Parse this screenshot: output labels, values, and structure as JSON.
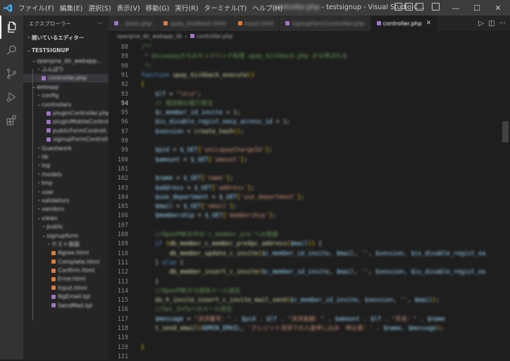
{
  "titlebar": {
    "menu": [
      "ファイル(F)",
      "編集(E)",
      "選択(S)",
      "表示(V)",
      "移動(G)",
      "実行(R)",
      "ターミナル(T)",
      "ヘルプ(H)"
    ],
    "title_prefix": "controller.php",
    "title": " - testsignup - Visual Studio C...",
    "minimize": "—",
    "maximize": "☐",
    "close": "✕"
  },
  "sidebar": {
    "header": "エクスプローラー",
    "more": "···",
    "open_editors": "開いているエディター",
    "workspace": "TESTSIGNUP",
    "items": [
      {
        "label": "openpne_dir_webapp...",
        "depth": 1,
        "tw": "⌄",
        "color": ""
      },
      {
        "label": "ふんばり",
        "depth": 2,
        "tw": "›",
        "color": ""
      },
      {
        "label": "controller.php",
        "depth": 2,
        "tw": "",
        "color": "#a074c4",
        "selected": true
      },
      {
        "label": "webapp",
        "depth": 1,
        "tw": "⌄",
        "color": ""
      },
      {
        "label": "config",
        "depth": 2,
        "tw": "›",
        "color": ""
      },
      {
        "label": "controllers",
        "depth": 2,
        "tw": "⌄",
        "color": ""
      },
      {
        "label": "pluginController.php",
        "depth": 3,
        "tw": "",
        "color": "#a074c4"
      },
      {
        "label": "pluginMobileControll...",
        "depth": 3,
        "tw": "",
        "color": "#a074c4"
      },
      {
        "label": "publicFormControll...",
        "depth": 3,
        "tw": "",
        "color": "#a074c4"
      },
      {
        "label": "signupFormControll...",
        "depth": 3,
        "tw": "",
        "color": "#a074c4"
      },
      {
        "label": "Guestwork",
        "depth": 2,
        "tw": "›",
        "color": ""
      },
      {
        "label": "lib",
        "depth": 2,
        "tw": "›",
        "color": ""
      },
      {
        "label": "log",
        "depth": 2,
        "tw": "›",
        "color": ""
      },
      {
        "label": "models",
        "depth": 2,
        "tw": "›",
        "color": ""
      },
      {
        "label": "tmp",
        "depth": 2,
        "tw": "›",
        "color": ""
      },
      {
        "label": "user",
        "depth": 2,
        "tw": "›",
        "color": ""
      },
      {
        "label": "validators",
        "depth": 2,
        "tw": "›",
        "color": ""
      },
      {
        "label": "vendors",
        "depth": 2,
        "tw": "›",
        "color": ""
      },
      {
        "label": "views",
        "depth": 2,
        "tw": "⌄",
        "color": ""
      },
      {
        "label": "public",
        "depth": 3,
        "tw": "›",
        "color": ""
      },
      {
        "label": "signupform",
        "depth": 3,
        "tw": "⌄",
        "color": ""
      },
      {
        "label": "テスト画面",
        "depth": 4,
        "tw": "›",
        "color": ""
      },
      {
        "label": "Agree.html",
        "depth": 4,
        "tw": "",
        "color": "#e37933"
      },
      {
        "label": "Complete.html",
        "depth": 4,
        "tw": "",
        "color": "#e37933"
      },
      {
        "label": "Confirm.html",
        "depth": 4,
        "tw": "",
        "color": "#e37933"
      },
      {
        "label": "Error.html",
        "depth": 4,
        "tw": "",
        "color": "#e37933"
      },
      {
        "label": "Input.html",
        "depth": 4,
        "tw": "",
        "color": "#e37933"
      },
      {
        "label": "NgEmail.tpl",
        "depth": 4,
        "tw": "",
        "color": "#a074c4"
      },
      {
        "label": "SendMail.tpl",
        "depth": 4,
        "tw": "",
        "color": "#a074c4"
      }
    ]
  },
  "tabs": [
    {
      "label": "...back.php",
      "color": "#a074c4",
      "active": false
    },
    {
      "label": "upay_kickback.html",
      "color": "#e37933",
      "active": false
    },
    {
      "label": "Input.html",
      "color": "#e37933",
      "active": false
    },
    {
      "label": "signupFormController.php",
      "color": "#a074c4",
      "active": false
    },
    {
      "label": "controller.php",
      "color": "#a074c4",
      "active": true
    }
  ],
  "tab_close": "✕",
  "tab_actions": [
    "▷",
    "◫",
    "···"
  ],
  "breadcrumb": [
    "openpne_dir_webapp_lib",
    "controller.php"
  ],
  "breadcrumb_sep": "›",
  "editor": {
    "current_line": 94,
    "lines": [
      {
        "n": "88",
        "t": [
          [
            "cm",
            "/**"
          ]
        ]
      },
      {
        "n": "89",
        "t": [
          [
            "cm",
            " * Unisepayからのキックバック処理 upay_kickback.php から呼ばれる"
          ]
        ]
      },
      {
        "n": "90",
        "t": [
          [
            "cm",
            " */"
          ]
        ]
      },
      {
        "n": "91",
        "t": [
          [
            "kw",
            "function "
          ],
          [
            "fn",
            "upay_kickback_execute"
          ],
          [
            "br",
            "()"
          ]
        ]
      },
      {
        "n": "92",
        "t": [
          [
            "br",
            "{"
          ]
        ]
      },
      {
        "n": "93",
        "t": [
          [
            "op",
            "    "
          ],
          [
            "var",
            "$lf"
          ],
          [
            "op",
            " = "
          ],
          [
            "str",
            "\"\\n\\n\""
          ],
          [
            "op",
            ";"
          ]
        ]
      },
      {
        "n": "94",
        "t": [
          [
            "op",
            "    "
          ],
          [
            "cm",
            "// 経営割の振り担当"
          ]
        ]
      },
      {
        "n": "95",
        "t": [
          [
            "op",
            "    "
          ],
          [
            "var",
            "$c_member_id_invite"
          ],
          [
            "op",
            " = "
          ],
          [
            "num",
            "1"
          ],
          [
            "op",
            ";"
          ]
        ]
      },
      {
        "n": "96",
        "t": [
          [
            "op",
            "    "
          ],
          [
            "var",
            "$is_disable_regist_easy_access_id"
          ],
          [
            "op",
            " = "
          ],
          [
            "num",
            "1"
          ],
          [
            "op",
            ";"
          ]
        ]
      },
      {
        "n": "97",
        "t": [
          [
            "op",
            "    "
          ],
          [
            "var",
            "$session"
          ],
          [
            "op",
            " = "
          ],
          [
            "fn",
            "create_hash"
          ],
          [
            "br",
            "()"
          ],
          [
            "op",
            ";"
          ]
        ]
      },
      {
        "n": "98",
        "t": []
      },
      {
        "n": "99",
        "t": [
          [
            "op",
            "    "
          ],
          [
            "var",
            "$pid"
          ],
          [
            "op",
            " = "
          ],
          [
            "var",
            "$_GET"
          ],
          [
            "br",
            "["
          ],
          [
            "str",
            "'unicapayChargeId'"
          ],
          [
            "br",
            "]"
          ],
          [
            "op",
            ";"
          ]
        ]
      },
      {
        "n": "100",
        "t": [
          [
            "op",
            "    "
          ],
          [
            "var",
            "$amount"
          ],
          [
            "op",
            " = "
          ],
          [
            "var",
            "$_GET"
          ],
          [
            "br",
            "["
          ],
          [
            "str",
            "'amount'"
          ],
          [
            "br",
            "]"
          ],
          [
            "op",
            ";"
          ]
        ]
      },
      {
        "n": "101",
        "t": []
      },
      {
        "n": "102",
        "t": [
          [
            "op",
            "    "
          ],
          [
            "var",
            "$name"
          ],
          [
            "op",
            " = "
          ],
          [
            "var",
            "$_GET"
          ],
          [
            "br",
            "["
          ],
          [
            "str",
            "'name'"
          ],
          [
            "br",
            "]"
          ],
          [
            "op",
            ";"
          ]
        ]
      },
      {
        "n": "103",
        "t": [
          [
            "op",
            "    "
          ],
          [
            "var",
            "$address"
          ],
          [
            "op",
            " = "
          ],
          [
            "var",
            "$_GET"
          ],
          [
            "br",
            "["
          ],
          [
            "str",
            "'address'"
          ],
          [
            "br",
            "]"
          ],
          [
            "op",
            ";"
          ]
        ]
      },
      {
        "n": "104",
        "t": [
          [
            "op",
            "    "
          ],
          [
            "var",
            "$use_department"
          ],
          [
            "op",
            " = "
          ],
          [
            "var",
            "$_GET"
          ],
          [
            "br",
            "["
          ],
          [
            "str",
            "'use_department'"
          ],
          [
            "br",
            "]"
          ],
          [
            "op",
            ";"
          ]
        ]
      },
      {
        "n": "105",
        "t": [
          [
            "op",
            "    "
          ],
          [
            "var",
            "$mail"
          ],
          [
            "op",
            " = "
          ],
          [
            "var",
            "$_GET"
          ],
          [
            "br",
            "["
          ],
          [
            "str",
            "'email'"
          ],
          [
            "br",
            "]"
          ],
          [
            "op",
            ";"
          ]
        ]
      },
      {
        "n": "106",
        "t": [
          [
            "op",
            "    "
          ],
          [
            "var",
            "$membership"
          ],
          [
            "op",
            " = "
          ],
          [
            "var",
            "$_GET"
          ],
          [
            "br",
            "["
          ],
          [
            "str",
            "'membership'"
          ],
          [
            "br",
            "]"
          ],
          [
            "op",
            ";"
          ]
        ]
      },
      {
        "n": "107",
        "t": []
      },
      {
        "n": "108",
        "t": [
          [
            "op",
            "    "
          ],
          [
            "cm",
            "//OpenPNEの中の'c_member_pre'への登録"
          ]
        ]
      },
      {
        "n": "109",
        "t": [
          [
            "op",
            "    "
          ],
          [
            "kw",
            "if "
          ],
          [
            "br",
            "("
          ],
          [
            "fn",
            "db_member_c_member_pre4pc_address"
          ],
          [
            "br",
            "("
          ],
          [
            "var",
            "$mail"
          ],
          [
            "br",
            ")"
          ],
          [
            "br",
            ")"
          ],
          [
            "op",
            " {"
          ]
        ]
      },
      {
        "n": "110",
        "t": [
          [
            "op",
            "        "
          ],
          [
            "fn",
            "db_member_update_c_invite"
          ],
          [
            "br",
            "("
          ],
          [
            "var",
            "$c_member_id_invite, $mail"
          ],
          [
            "op",
            ", '', "
          ],
          [
            "var",
            "$session, $is_disable_regist_ea"
          ]
        ]
      },
      {
        "n": "111",
        "t": [
          [
            "op",
            "    } "
          ],
          [
            "kw",
            "else"
          ],
          [
            "op",
            " {"
          ]
        ]
      },
      {
        "n": "112",
        "t": [
          [
            "op",
            "        "
          ],
          [
            "fn",
            "db_member_insert_c_invite"
          ],
          [
            "br",
            "("
          ],
          [
            "var",
            "$c_member_id_invite, $mail"
          ],
          [
            "op",
            ", '', "
          ],
          [
            "var",
            "$session, $is_disable_regist_ea"
          ]
        ]
      },
      {
        "n": "113",
        "t": [
          [
            "op",
            "    }"
          ]
        ]
      },
      {
        "n": "114",
        "t": [
          [
            "op",
            "    "
          ],
          [
            "cm",
            "//OpenPNEから招待メール送信"
          ]
        ]
      },
      {
        "n": "115",
        "t": [
          [
            "op",
            "    "
          ],
          [
            "fn",
            "do_h_invite_insert_c_invite_mail_send"
          ],
          [
            "br",
            "("
          ],
          [
            "var",
            "$c_member_id_invite, $session"
          ],
          [
            "op",
            ", '', "
          ],
          [
            "var",
            "$mail"
          ],
          [
            "br",
            ")"
          ],
          [
            "op",
            ";"
          ]
        ]
      },
      {
        "n": "116",
        "t": [
          [
            "op",
            "    "
          ],
          [
            "cm",
            "//Sec_Infoへのメール送信"
          ]
        ]
      },
      {
        "n": "117",
        "t": [
          [
            "op",
            "    "
          ],
          [
            "var",
            "$message"
          ],
          [
            "op",
            " = "
          ],
          [
            "str",
            "\"決済番号：\""
          ],
          [
            "op",
            " . "
          ],
          [
            "var",
            "$pid"
          ],
          [
            "op",
            " . "
          ],
          [
            "var",
            "$lf"
          ],
          [
            "op",
            " . "
          ],
          [
            "str",
            "\"決済金額：\""
          ],
          [
            "op",
            " . "
          ],
          [
            "var",
            "$amount"
          ],
          [
            "op",
            " . "
          ],
          [
            "var",
            "$lf"
          ],
          [
            "op",
            " . "
          ],
          [
            "str",
            "\"氏名：\""
          ],
          [
            "op",
            " . "
          ],
          [
            "var",
            "$name"
          ]
        ]
      },
      {
        "n": "118",
        "t": [
          [
            "op",
            "    "
          ],
          [
            "fn",
            "t_send_email"
          ],
          [
            "br",
            "("
          ],
          [
            "var",
            "ADMIN_EMAIL"
          ],
          [
            "op",
            ", "
          ],
          [
            "str",
            "'クレジット決済での入金申し込み　申込者：'"
          ],
          [
            "op",
            " . "
          ],
          [
            "var",
            "$name, $message"
          ],
          [
            "br",
            ")"
          ],
          [
            "op",
            ";"
          ]
        ]
      },
      {
        "n": "119",
        "t": []
      },
      {
        "n": "120",
        "t": [
          [
            "br",
            "}"
          ]
        ]
      },
      {
        "n": "121",
        "t": []
      }
    ]
  }
}
